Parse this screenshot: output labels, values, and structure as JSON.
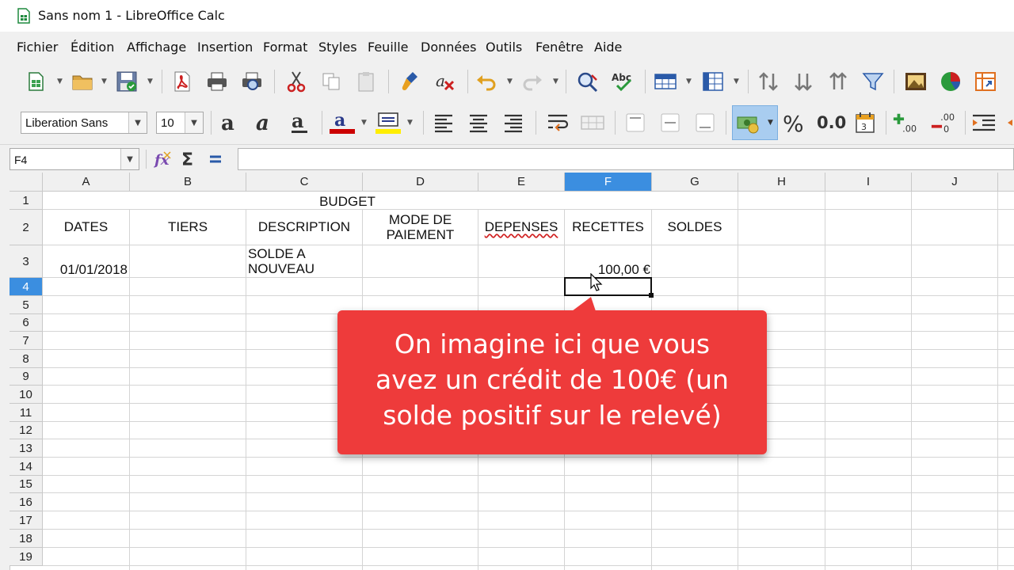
{
  "window": {
    "title": "Sans nom 1 - LibreOffice Calc"
  },
  "menu": [
    "Fichier",
    "Édition",
    "Affichage",
    "Insertion",
    "Format",
    "Styles",
    "Feuille",
    "Données",
    "Outils",
    "Fenêtre",
    "Aide"
  ],
  "toolbar": {
    "font_name": "Liberation Sans",
    "font_size": "10",
    "percent_label": "%",
    "number_label": "0.0",
    "colors": {
      "font_color": "#cc0000",
      "highlight_color": "#ffee00",
      "accent": "#3b8ee0"
    }
  },
  "formula_bar": {
    "cell_ref": "F4",
    "content": ""
  },
  "columns": [
    "A",
    "B",
    "C",
    "D",
    "E",
    "F",
    "G",
    "H",
    "I",
    "J"
  ],
  "selected_column": "F",
  "rows": [
    "1",
    "2",
    "3",
    "4",
    "5",
    "6",
    "7",
    "8",
    "9",
    "10",
    "11",
    "12",
    "13",
    "14",
    "15",
    "16",
    "17",
    "18",
    "19"
  ],
  "selected_row": "4",
  "cells": {
    "C1": "BUDGET",
    "A2": "DATES",
    "B2": "TIERS",
    "C2": "DESCRIPTION",
    "D2_line1": "MODE DE",
    "D2_line2": "PAIEMENT",
    "E2": "DEPENSES",
    "F2": "RECETTES",
    "G2": "SOLDES",
    "A3": "01/01/2018",
    "C3_line1": "SOLDE A",
    "C3_line2": "NOUVEAU",
    "F3": "100,00 €"
  },
  "callout": {
    "line1": "On imagine ici que vous",
    "line2": "avez un crédit de 100€ (un",
    "line3": "solde positif sur le relevé)"
  }
}
